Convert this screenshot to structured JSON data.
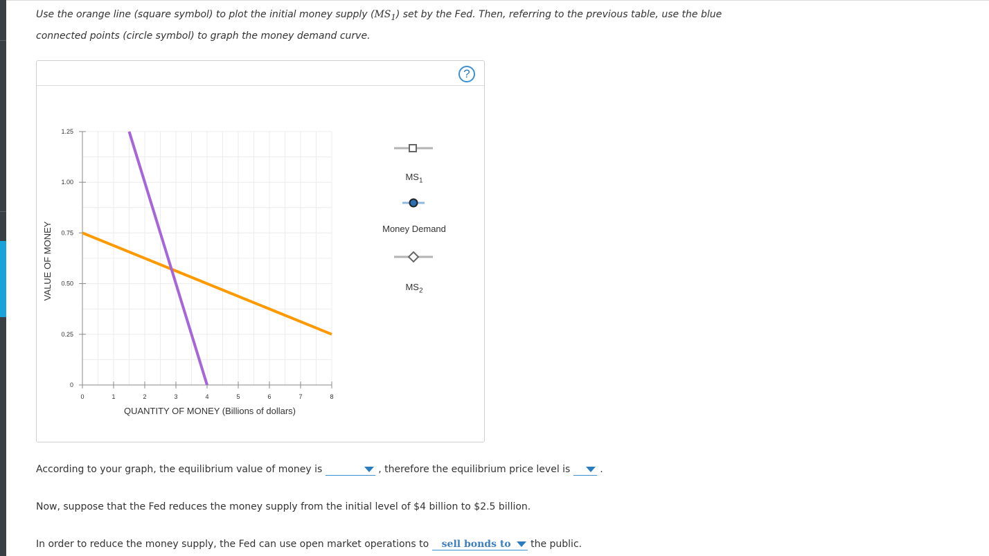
{
  "instructions": {
    "line1_a": "Use the orange line (square symbol) to plot the initial money supply (",
    "line1_math": "MS",
    "line1_math_sub": "1",
    "line1_b": ") set by the Fed. Then, referring to the previous table, use the blue",
    "line2": "connected points (circle symbol) to graph the money demand curve."
  },
  "help_button": {
    "label": "?"
  },
  "chart_data": {
    "type": "line",
    "xlabel": "QUANTITY OF MONEY (Billions of dollars)",
    "ylabel": "VALUE OF MONEY",
    "xlim": [
      0,
      8
    ],
    "ylim": [
      0,
      1.25
    ],
    "x_ticks": [
      "0",
      "1",
      "2",
      "3",
      "4",
      "5",
      "6",
      "7",
      "8"
    ],
    "y_ticks": [
      "0",
      "0.25",
      "0.50",
      "0.75",
      "1.00",
      "1.25"
    ],
    "y_tick_values": [
      0,
      0.25,
      0.5,
      0.75,
      1.0,
      1.25
    ],
    "grid": true,
    "legend_position": "right",
    "series": [
      {
        "name": "MS1",
        "color": "#ff9900",
        "points": [
          [
            0,
            0.75
          ],
          [
            8,
            0.25
          ]
        ]
      },
      {
        "name": "",
        "color": "#a666d9",
        "points": [
          [
            1.5,
            1.25
          ],
          [
            4,
            0
          ]
        ]
      }
    ]
  },
  "legend": {
    "items": [
      {
        "label": "MS",
        "sub": "1",
        "marker": "square",
        "line_color": "#b3b3b3",
        "marker_color": "#666666",
        "marker_fill": "#ffffff"
      },
      {
        "label": "Money Demand",
        "sub": "",
        "marker": "circle",
        "line_color": "#8fb8dd",
        "marker_color": "#222222",
        "marker_fill": "#2b6fb3"
      },
      {
        "label": "MS",
        "sub": "2",
        "marker": "diamond",
        "line_color": "#b3b3b3",
        "marker_color": "#666666",
        "marker_fill": "#ffffff"
      }
    ]
  },
  "question1": {
    "text_a": "According to your graph, the equilibrium value of money is",
    "dropdown1_value": "",
    "text_b": ", therefore the equilibrium price level is",
    "dropdown2_value": "",
    "text_c": "."
  },
  "question2": {
    "text": "Now, suppose that the Fed reduces the money supply from the initial level of $4 billion to $2.5 billion."
  },
  "question3": {
    "text_a": "In order to reduce the money supply, the Fed can use open market operations to",
    "dropdown_value": "sell bonds to",
    "text_b": "the public."
  }
}
